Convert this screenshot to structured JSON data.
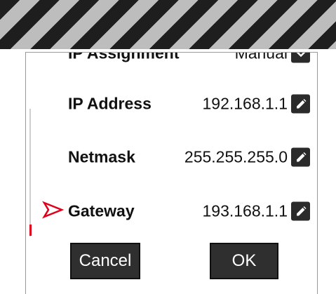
{
  "fields": [
    {
      "id": "ip_assignment",
      "label": "IP Assignment",
      "value": "Manual"
    },
    {
      "id": "ip_address",
      "label": "IP Address",
      "value": "192.168.1.1"
    },
    {
      "id": "netmask",
      "label": "Netmask",
      "value": "255.255.255.0"
    },
    {
      "id": "gateway",
      "label": "Gateway",
      "value": "193.168.1.1"
    }
  ],
  "buttons": {
    "cancel": "Cancel",
    "ok": "OK"
  },
  "selected_field": "Gateway",
  "icons": {
    "edit": "pencil-icon",
    "dropdown": "chevron-down-icon",
    "pointer": "arrow-right-icon"
  },
  "colors": {
    "accent": "#e0001b",
    "button_bg": "#2f2f2f",
    "edit_icon_bg": "#2b2b2b"
  }
}
